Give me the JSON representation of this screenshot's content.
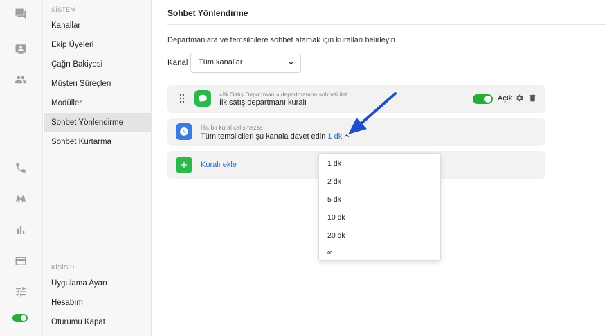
{
  "rail": {
    "icons": [
      "chat-icon",
      "contacts-icon",
      "team-icon",
      "phone-icon",
      "binoculars-icon",
      "bar-chart-icon",
      "card-icon",
      "sliders-icon",
      "toggle-icon"
    ]
  },
  "sidebar": {
    "section_system": "SİSTEM",
    "items": [
      {
        "label": "Kanallar"
      },
      {
        "label": "Ekip Üyeleri"
      },
      {
        "label": "Çağrı Bakiyesi"
      },
      {
        "label": "Müşteri Süreçleri"
      },
      {
        "label": "Modüller"
      },
      {
        "label": "Sohbet Yönlendirme"
      },
      {
        "label": "Sohbet Kurtarma"
      }
    ],
    "section_personal": "KİŞİSEL",
    "personal_items": [
      {
        "label": "Uygulama Ayarı"
      },
      {
        "label": "Hesabım"
      },
      {
        "label": "Oturumu Kapat"
      }
    ]
  },
  "main": {
    "title": "Sohbet Yönlendirme",
    "description": "Departmanlara ve temsilcilere sohbet atamak için kuralları belirleyin",
    "channel_label": "Kanal",
    "channel_value": "Tüm kanallar",
    "rule1": {
      "subtitle": "«İlk Satış Departmanı» departmanına sohbeti ilet",
      "title": "İlk satış departmanı kuralı",
      "toggle_label": "Açık"
    },
    "rule2": {
      "subtitle": "Hiç bir kural çalışmazsa",
      "title_prefix": "Tüm temsilcileri şu kanala davet edin",
      "title_value": "1 dk"
    },
    "add_rule": "Kuralı ekle",
    "dropdown_options": [
      "1 dk",
      "2 dk",
      "5 dk",
      "10 dk",
      "20 dk",
      "∞"
    ]
  },
  "colors": {
    "accent_green": "#2db84c",
    "accent_blue": "#3d7be0",
    "link_blue": "#2f6fd4",
    "annotation_arrow": "#1f4fc9"
  }
}
